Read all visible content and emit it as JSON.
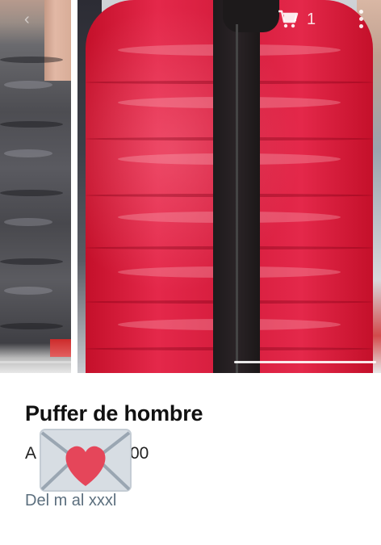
{
  "header": {
    "back_icon": "chevron-left-icon",
    "cart_icon": "shopping-cart-icon",
    "cart_count": "1",
    "menu_icon": "more-vertical-icon"
  },
  "gallery": {
    "photos": [
      {
        "subject": "gray-puffer-jacket"
      },
      {
        "subject": "red-puffer-jacket"
      }
    ]
  },
  "product": {
    "title": "Puffer de hombre",
    "price_prefix": "A",
    "price_suffix": "00",
    "description": "Del m al xxxl"
  },
  "overlay": {
    "emoji_icon": "love-letter-icon"
  },
  "colors": {
    "title": "#111111",
    "description": "#5c6f7e",
    "jacket_red": "#d41c3c",
    "heart": "#e5465a",
    "envelope": "#d7dde3"
  }
}
